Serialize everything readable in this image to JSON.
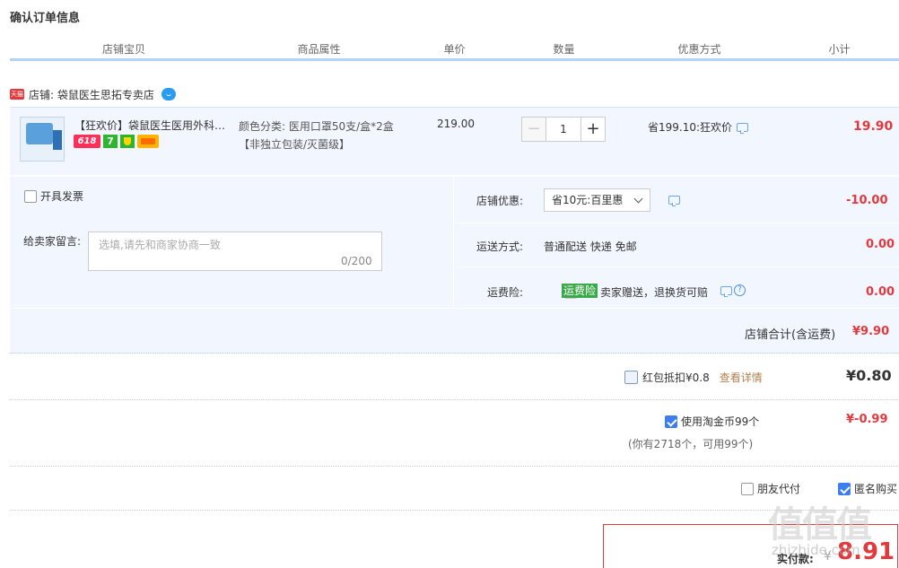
{
  "page": {
    "title": "确认订单信息"
  },
  "header": {
    "columns": [
      "店铺宝贝",
      "商品属性",
      "单价",
      "数量",
      "优惠方式",
      "小计"
    ]
  },
  "shop": {
    "badge": "天猫",
    "label": "店铺: 袋鼠医生思拓专卖店"
  },
  "item": {
    "title": "【狂欢价】袋鼠医生医用外科口罩一次性医疗",
    "badges": [
      "618",
      "7"
    ],
    "attr_line1": "颜色分类: 医用口罩50支/盒*2盒",
    "attr_line2": "【非独立包装/灭菌级】",
    "unit_price": "219.00",
    "quantity": "1",
    "minus": "−",
    "plus": "+",
    "promo": "省199.10:狂欢价",
    "subtotal": "19.90"
  },
  "options": {
    "invoice_label": "开具发票",
    "message_label": "给卖家留言:",
    "message_placeholder": "选填,请先和商家协商一致",
    "message_count": "0/200",
    "shop_discount_label": "店铺优惠:",
    "shop_discount_selected": "省10元:百里惠",
    "shop_discount_value": "-10.00",
    "shipping_label": "运送方式:",
    "shipping_text": "普通配送 快递 免邮",
    "shipping_value": "0.00",
    "insurance_label": "运费险:",
    "insurance_tag": "运费险",
    "insurance_text": "卖家赠送，退换货可赔",
    "insurance_help": "?",
    "insurance_value": "0.00"
  },
  "shop_total": {
    "label": "店铺合计(含运费)",
    "value": "¥9.90"
  },
  "hongbao": {
    "label": "红包抵扣¥0.8",
    "link": "查看详情",
    "value": "¥0.80"
  },
  "coins": {
    "label": "使用淘金币99个",
    "value": "¥-0.99",
    "sub": "(你有2718个，可用99个)"
  },
  "extra": {
    "friend_pay": "朋友代付",
    "anonymous": "匿名购买"
  },
  "payment": {
    "label": "实付款:",
    "currency": "¥",
    "amount": "8.91"
  },
  "watermark": {
    "logo": "值值值",
    "text": "zhizhide.com"
  }
}
